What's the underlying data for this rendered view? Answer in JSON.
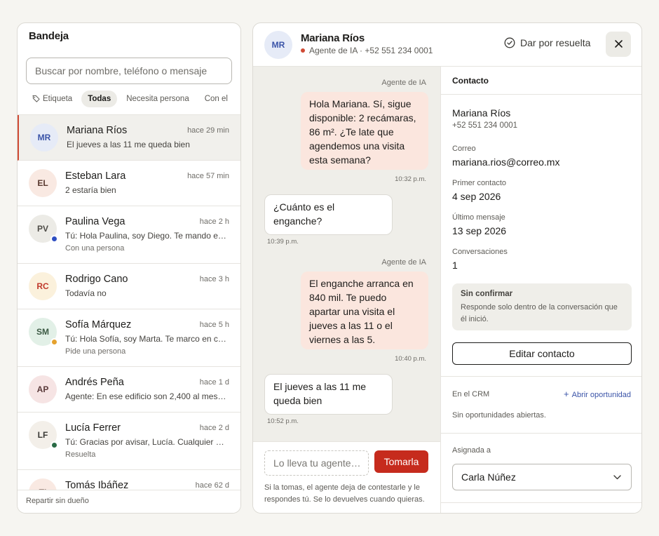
{
  "inbox": {
    "title": "Bandeja",
    "search_placeholder": "Buscar por nombre, teléfono o mensaje",
    "filters": [
      {
        "label": "Etiqueta",
        "icon": "tag-icon",
        "active": false
      },
      {
        "label": "Todas",
        "active": true
      },
      {
        "label": "Necesita persona",
        "active": false
      },
      {
        "label": "Con el",
        "active": false
      }
    ],
    "conversations": [
      {
        "initials": "MR",
        "name": "Mariana Ríos",
        "time": "hace 29 min",
        "message": "El jueves a las 11 me queda bien",
        "sub": "",
        "active": true,
        "status_color": ""
      },
      {
        "initials": "EL",
        "name": "Esteban Lara",
        "time": "hace 57 min",
        "message": "2 estaría bien",
        "sub": "",
        "active": false,
        "status_color": ""
      },
      {
        "initials": "PV",
        "name": "Paulina Vega",
        "time": "hace 2 h",
        "message": "Tú: Hola Paulina, soy Diego. Te mando el …",
        "sub": "Con una persona",
        "active": false,
        "status_color": "#2f4fc2"
      },
      {
        "initials": "RC",
        "name": "Rodrigo Cano",
        "time": "hace 3 h",
        "message": "Todavía no",
        "sub": "",
        "active": false,
        "status_color": ""
      },
      {
        "initials": "SM",
        "name": "Sofía Márquez",
        "time": "hace 5 h",
        "message": "Tú: Hola Sofía, soy Marta. Te marco en cin…",
        "sub": "Pide una persona",
        "active": false,
        "status_color": "#e5a22e"
      },
      {
        "initials": "AP",
        "name": "Andrés Peña",
        "time": "hace 1 d",
        "message": "Agente: En ese edificio son 2,400 al mes …",
        "sub": "",
        "active": false,
        "status_color": ""
      },
      {
        "initials": "LF",
        "name": "Lucía Ferrer",
        "time": "hace 2 d",
        "message": "Tú: Gracias por avisar, Lucía. Cualquier co…",
        "sub": "Resuelta",
        "active": false,
        "status_color": "#2a6b45"
      },
      {
        "initials": "TI",
        "name": "Tomás Ibáñez",
        "time": "hace 62 d",
        "message": "",
        "sub": "",
        "active": false,
        "status_color": ""
      }
    ],
    "footer": "Repartir sin dueño"
  },
  "chat": {
    "header": {
      "initials": "MR",
      "name": "Mariana Ríos",
      "subtitle": "Agente de IA · +52 551 234 0001",
      "resolve_label": "Dar por resuelta",
      "close_icon": "close-icon"
    },
    "messages": [
      {
        "from": "agent",
        "sender_label": "Agente de IA",
        "text": "Hola Mariana. Sí, sigue disponible: 2 recámaras, 86 m². ¿Te late que agendemos una visita esta semana?",
        "time": "10:32 p.m."
      },
      {
        "from": "contact",
        "sender_label": "",
        "text": "¿Cuánto es el enganche?",
        "time": "10:39 p.m."
      },
      {
        "from": "agent",
        "sender_label": "Agente de IA",
        "text": "El enganche arranca en 840 mil. Te puedo apartar una visita el jueves a las 11 o el viernes a las 5.",
        "time": "10:40 p.m."
      },
      {
        "from": "contact",
        "sender_label": "",
        "text": "El jueves a las 11 me queda bien",
        "time": "10:52 p.m."
      }
    ],
    "composer": {
      "placeholder": "Lo lleva tu agente…",
      "take_label": "Tomarla",
      "note": "Si la tomas, el agente deja de contestarle y le respondes tú. Se lo devuelves cuando quieras."
    }
  },
  "contact": {
    "title": "Contacto",
    "name": "Mariana Ríos",
    "phone": "+52 551 234 0001",
    "email_label": "Correo",
    "email": "mariana.rios@correo.mx",
    "first_contact_label": "Primer contacto",
    "first_contact": "4 sep 2026",
    "last_message_label": "Último mensaje",
    "last_message": "13 sep 2026",
    "conversations_label": "Conversaciones",
    "conversations": "1",
    "unconfirmed_title": "Sin confirmar",
    "unconfirmed_desc": "Responde solo dentro de la conversación que él inició.",
    "edit_label": "Editar contacto",
    "crm_label": "En el CRM",
    "crm_link": "Abrir oportunidad",
    "crm_empty": "Sin oportunidades abiertas.",
    "assigned_label": "Asignada a",
    "assigned_to": "Carla Núñez"
  },
  "colors": {
    "accent": "#c62b1d",
    "agent_bubble": "#fbe6de",
    "link": "#3b54a8"
  }
}
